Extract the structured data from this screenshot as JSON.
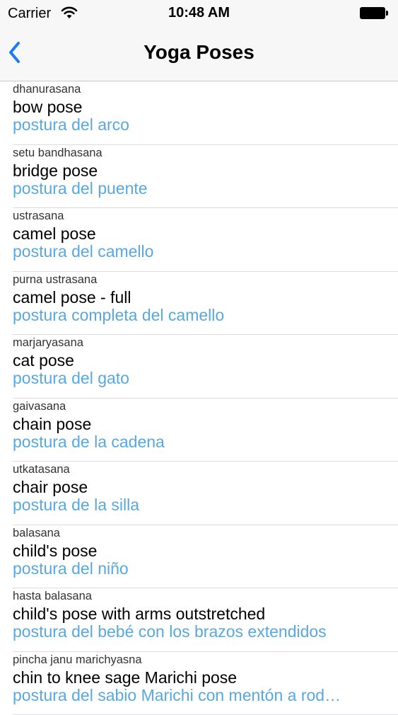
{
  "status_bar": {
    "carrier": "Carrier",
    "time": "10:48 AM"
  },
  "nav": {
    "title": "Yoga Poses",
    "back_icon": "chevron-left-icon"
  },
  "colors": {
    "accent": "#1a7cf5",
    "translation": "#58a8e0"
  },
  "poses": [
    {
      "sanskrit": "dhanurasana",
      "english": "bow pose",
      "spanish": "postura del arco"
    },
    {
      "sanskrit": "setu bandhasana",
      "english": "bridge pose",
      "spanish": "postura del puente"
    },
    {
      "sanskrit": "ustrasana",
      "english": "camel pose",
      "spanish": "postura del camello"
    },
    {
      "sanskrit": "purna ustrasana",
      "english": "camel pose - full",
      "spanish": "postura completa del camello"
    },
    {
      "sanskrit": "marjaryasana",
      "english": "cat pose",
      "spanish": "postura del gato"
    },
    {
      "sanskrit": "gaivasana",
      "english": "chain pose",
      "spanish": "postura de la cadena"
    },
    {
      "sanskrit": "utkatasana",
      "english": "chair pose",
      "spanish": "postura de la silla"
    },
    {
      "sanskrit": "balasana",
      "english": "child's pose",
      "spanish": "postura del niño"
    },
    {
      "sanskrit": "hasta balasana",
      "english": "child's pose with arms outstretched",
      "spanish": "postura del bebé con los brazos extendidos"
    },
    {
      "sanskrit": "pincha janu marichyasna",
      "english": "chin to knee sage Marichi pose",
      "spanish": "postura del sabio Marichi con mentón a rod…"
    }
  ]
}
